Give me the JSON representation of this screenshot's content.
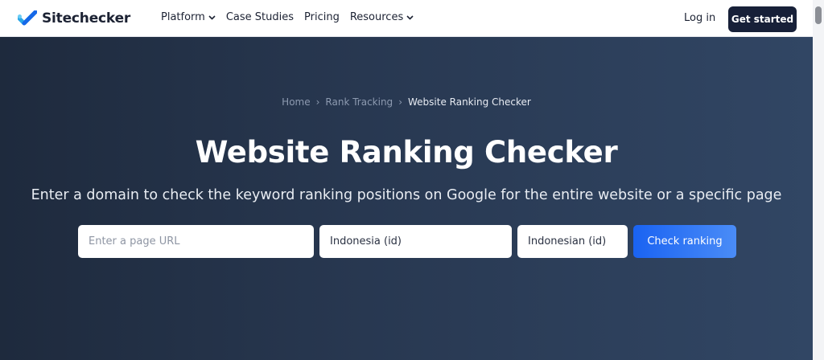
{
  "header": {
    "brand": "Sitechecker",
    "nav": [
      {
        "label": "Platform",
        "has_dropdown": true
      },
      {
        "label": "Case Studies",
        "has_dropdown": false
      },
      {
        "label": "Pricing",
        "has_dropdown": false
      },
      {
        "label": "Resources",
        "has_dropdown": true
      }
    ],
    "login_label": "Log in",
    "cta_label": "Get started"
  },
  "breadcrumb": [
    {
      "label": "Home"
    },
    {
      "label": "Rank Tracking"
    },
    {
      "label": "Website Ranking Checker"
    }
  ],
  "hero": {
    "title": "Website Ranking Checker",
    "subtitle": "Enter a domain to check the keyword ranking positions on Google for the entire website or a specific page"
  },
  "form": {
    "url_placeholder": "Enter a page URL",
    "country_value": "Indonesia (id)",
    "language_value": "Indonesian (id)",
    "submit_label": "Check ranking"
  },
  "colors": {
    "brand_blue": "#1a63f2",
    "header_cta_bg": "#172038",
    "hero_bg_start": "#1e2a3d",
    "hero_bg_end": "#314664"
  },
  "icons": {
    "logo": "checkmark-logo-icon",
    "nav_dropdown": "chevron-down-icon"
  }
}
